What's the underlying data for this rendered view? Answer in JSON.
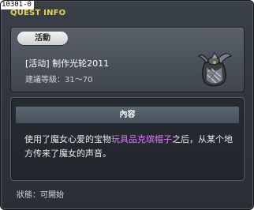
{
  "window": {
    "id_tag": "10301-0",
    "title": "QUEST INFO"
  },
  "quest": {
    "category_label": "活動",
    "name": "[活动] 制作光轮2011",
    "level_label": "建議等級：31～70",
    "item_icon": "wrapped-hat-item-icon"
  },
  "content": {
    "header": "內容",
    "text_before": "使用了魔女心爱的宝物",
    "text_highlight": "玩具品克缤帽子",
    "text_after": "之后，从某个地方传来了魔女的声音。",
    "highlight_color": "#d77cf0"
  },
  "status": {
    "label": "狀態：可開始"
  }
}
